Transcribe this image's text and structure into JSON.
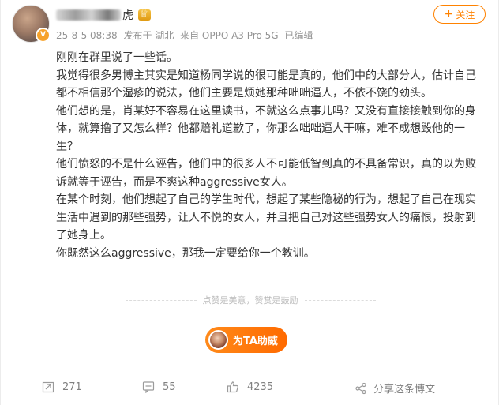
{
  "header": {
    "name_suffix": "虎",
    "meta": {
      "time": "25-8-5 08:38",
      "location": "发布于 湖北",
      "source": "来自 OPPO A3 Pro 5G",
      "edited": "已编辑"
    },
    "follow_label": "关注",
    "follow_plus": "+"
  },
  "post": {
    "paragraphs": [
      "刚刚在群里说了一些话。",
      "我觉得很多男博主其实是知道杨同学说的很可能是真的，他们中的大部分人，估计自己都不相信那个湿疹的说法，他们主要是烦她那种咄咄逼人，不依不饶的劲头。",
      "他们想的是，肖某好不容易在这里读书，不就这么点事儿吗？又没有直接接触到你的身体，就算撸了又怎么样？他都赔礼道歉了，你那么咄咄逼人干嘛，难不成想毁他的一生？",
      "他们愤怒的不是什么诬告，他们中的很多人不可能低智到真的不具备常识，真的以为败诉就等于诬告，而是不爽这种aggressive女人。",
      "在某个时刻，他们想起了自己的学生时代，想起了某些隐秘的行为，想起了自己在现实生活中遇到的那些强势，让人不悦的女人，并且把自己对这些强势女人的痛恨，投射到了她身上。",
      "你既然这么aggressive，那我一定要给你一个教训。"
    ]
  },
  "reward": {
    "praise_text": "点赞是美意，赞赏是鼓励",
    "button_label": "为TA助威"
  },
  "footer": {
    "repost_count": "271",
    "comment_count": "55",
    "like_count": "4235",
    "share_label": "分享这条博文"
  },
  "colors": {
    "accent": "#ff8200",
    "text": "#333333",
    "muted": "#939393"
  }
}
